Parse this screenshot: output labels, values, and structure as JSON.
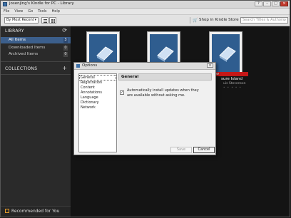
{
  "window": {
    "title": "josenjing's Kindle for PC - Library",
    "controls": [
      "?",
      "–",
      "□",
      "✕"
    ]
  },
  "menu": [
    "File",
    "View",
    "Go",
    "Tools",
    "Help"
  ],
  "toolbar": {
    "sort_label": "By Most Recent",
    "store_label": "Shop in Kindle Store",
    "search_placeholder": "Search Titles & Authors"
  },
  "sidebar": {
    "library_title": "LIBRARY",
    "items": [
      {
        "label": "All Items",
        "count": "3"
      },
      {
        "label": "Downloaded Items",
        "count": "0"
      },
      {
        "label": "Archived Items",
        "count": "0"
      }
    ],
    "collections_title": "COLLECTIONS",
    "recommended_label": "Recommended for You"
  },
  "library": {
    "new_badge": "New",
    "book_title": "sure Island",
    "book_author": "uis Stevenson",
    "book_dots": "• • • • •"
  },
  "dialog": {
    "title": "Options",
    "close": "x",
    "categories": [
      "General",
      "Registration",
      "Content",
      "Annotations",
      "Language",
      "Dictionary",
      "Network"
    ],
    "pane_title": "General",
    "auto_update_label": "Automatically install updates when they are available without asking me.",
    "save_label": "Save",
    "cancel_label": "Cancel"
  }
}
